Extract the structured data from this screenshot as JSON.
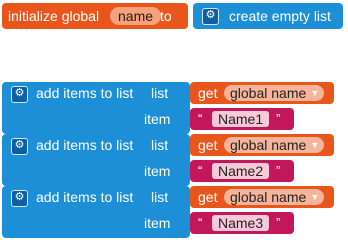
{
  "initialize": {
    "label": "initialize global",
    "var_name": "name",
    "to_label": "to",
    "value_block": "create empty list"
  },
  "add_blocks": [
    {
      "label": "add items to list",
      "list_label": "list",
      "item_label": "item",
      "get_label": "get",
      "get_var": "global name",
      "string_value": "Name1"
    },
    {
      "label": "add items to list",
      "list_label": "list",
      "item_label": "item",
      "get_label": "get",
      "get_var": "global name",
      "string_value": "Name2"
    },
    {
      "label": "add items to list",
      "list_label": "list",
      "item_label": "item",
      "get_label": "get",
      "get_var": "global name",
      "string_value": "Name3"
    }
  ],
  "icons": {
    "gear": "gear-icon",
    "dropdown": "dropdown-arrow-icon"
  },
  "colors": {
    "variable": "#e8561c",
    "list": "#1d8fd6",
    "text": "#c2185b"
  }
}
